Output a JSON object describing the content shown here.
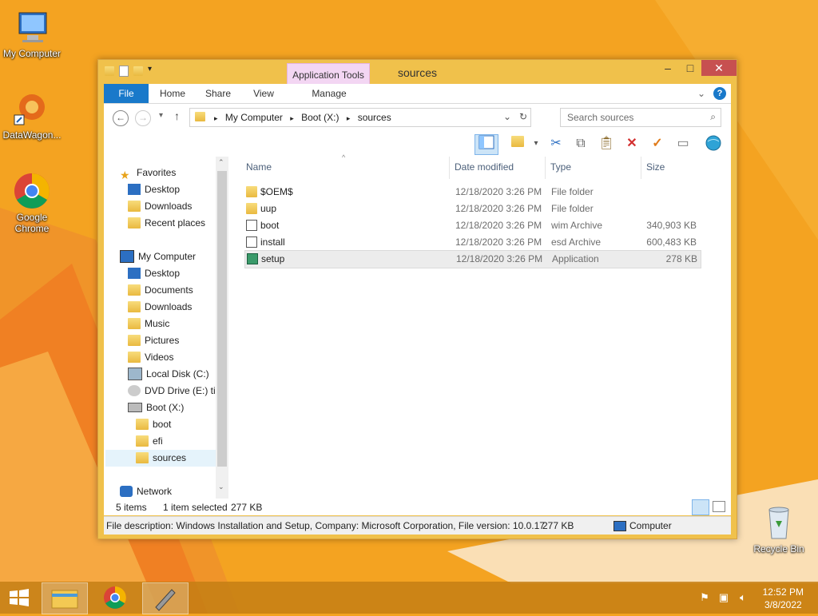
{
  "desktop": {
    "icons": [
      {
        "label": "My Computer"
      },
      {
        "label": "DataWagon..."
      },
      {
        "label": "Google Chrome"
      },
      {
        "label": "Recycle Bin"
      }
    ]
  },
  "window": {
    "title": "sources",
    "context_tab": "Application Tools",
    "ribbon_tabs": [
      "File",
      "Home",
      "Share",
      "View",
      "Manage"
    ],
    "breadcrumb": [
      "My Computer",
      "Boot (X:)",
      "sources"
    ],
    "search_placeholder": "Search sources",
    "columns": {
      "name": "Name",
      "date": "Date modified",
      "type": "Type",
      "size": "Size"
    },
    "files": [
      {
        "name": "$OEM$",
        "date": "12/18/2020 3:26 PM",
        "type": "File folder",
        "size": "",
        "icon": "folder-icon"
      },
      {
        "name": "uup",
        "date": "12/18/2020 3:26 PM",
        "type": "File folder",
        "size": "",
        "icon": "folder-icon"
      },
      {
        "name": "boot",
        "date": "12/18/2020 3:26 PM",
        "type": "wim Archive",
        "size": "340,903 KB",
        "icon": "archive-icon"
      },
      {
        "name": "install",
        "date": "12/18/2020 3:26 PM",
        "type": "esd Archive",
        "size": "600,483 KB",
        "icon": "archive-icon"
      },
      {
        "name": "setup",
        "date": "12/18/2020 3:26 PM",
        "type": "Application",
        "size": "278 KB",
        "icon": "setup-icon"
      }
    ],
    "nav": {
      "favorites": "Favorites",
      "fav_items": [
        "Desktop",
        "Downloads",
        "Recent places"
      ],
      "computer": "My Computer",
      "computer_items": [
        "Desktop",
        "Documents",
        "Downloads",
        "Music",
        "Pictures",
        "Videos",
        "Local Disk (C:)",
        "DVD Drive (E:) tin",
        "Boot (X:)"
      ],
      "boot_items": [
        "boot",
        "efi",
        "sources"
      ],
      "network": "Network"
    },
    "status": {
      "items": "5 items",
      "selected": "1 item selected",
      "size": "277 KB"
    },
    "description": {
      "text": "File description: Windows Installation and Setup, Company: Microsoft Corporation, File version: 10.0.17",
      "size": "277 KB",
      "location": "Computer"
    }
  },
  "taskbar": {
    "time": "12:52 PM",
    "date": "3/8/2022"
  }
}
